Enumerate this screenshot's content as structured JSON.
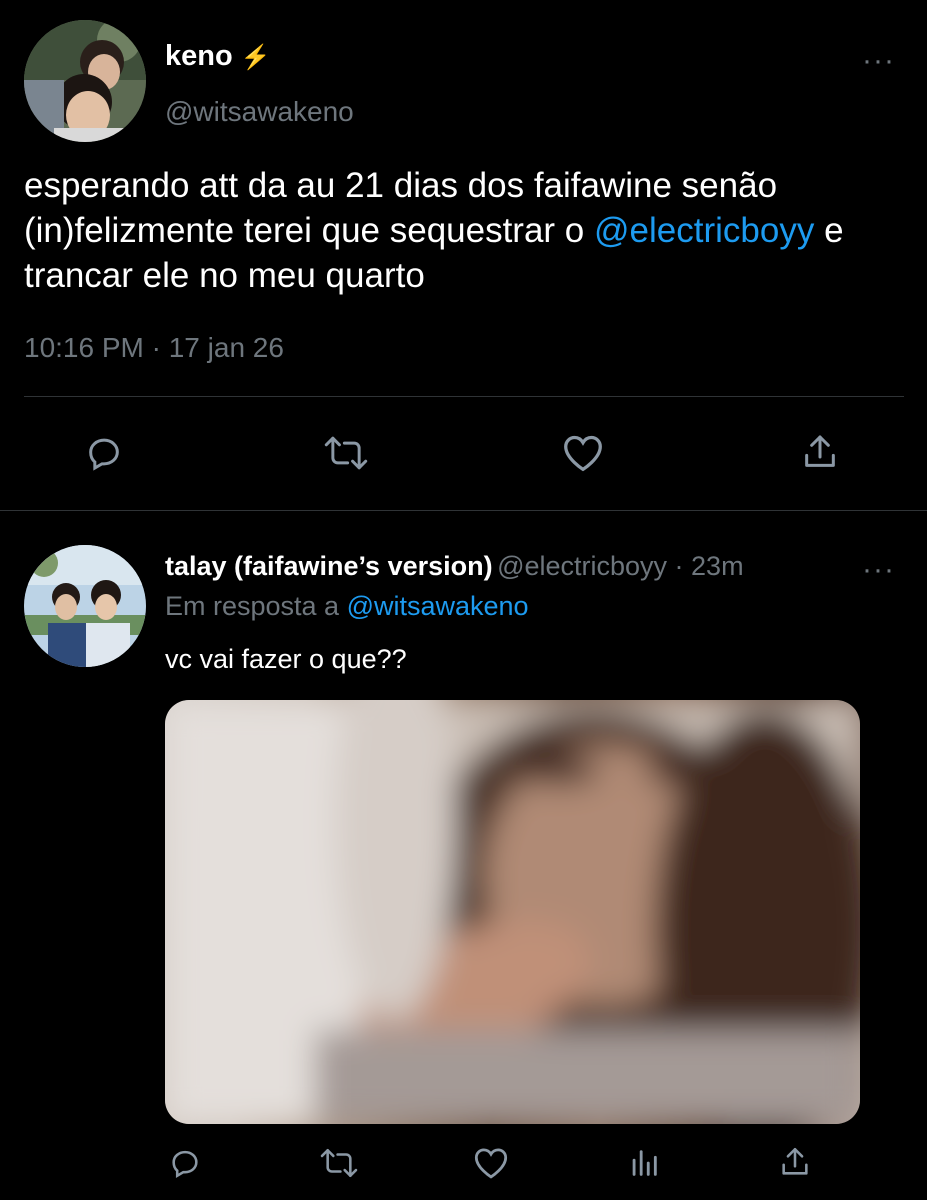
{
  "main_tweet": {
    "display_name": "keno",
    "badge_emoji": "⚡",
    "handle": "@witsawakeno",
    "text_before": "esperando att da au 21 dias dos faifawine senão (in)felizmente terei que sequestrar o",
    "mention": "@electricboyy",
    "text_after": " e trancar ele no meu quarto",
    "timestamp": "10:16 PM · 17 jan 26",
    "more_icon": "···",
    "actions": [
      "reply-icon",
      "retweet-icon",
      "like-icon",
      "share-icon"
    ]
  },
  "reply_tweet": {
    "display_name": "talay (faifawine’s version)",
    "handle": "@electricboyy",
    "time": " · 23m",
    "reply_label": "Em resposta a ",
    "reply_to": "@witsawakeno",
    "text": "vc vai fazer o que??",
    "more_icon": "···",
    "actions": [
      "reply-icon",
      "retweet-icon",
      "like-icon",
      "analytics-icon",
      "share-icon"
    ]
  },
  "colors": {
    "background": "#000000",
    "text": "#ffffff",
    "secondary": "#6e767d",
    "link": "#1d9bf0",
    "divider": "#2f3336",
    "icon": "#8b98a5"
  }
}
